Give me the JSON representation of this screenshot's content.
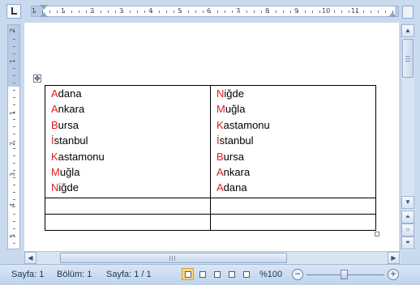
{
  "ruler": {
    "top_numbers": [
      "1",
      "1",
      "2",
      "3",
      "4",
      "5",
      "6",
      "7",
      "8",
      "9",
      "10",
      "11"
    ],
    "left_numbers": [
      "2",
      "1",
      "1",
      "2",
      "3",
      "4",
      "5"
    ]
  },
  "table": {
    "col1": [
      {
        "first": "A",
        "rest": "dana"
      },
      {
        "first": "A",
        "rest": "nkara"
      },
      {
        "first": "B",
        "rest": "ursa"
      },
      {
        "first": "İ",
        "rest": "stanbul"
      },
      {
        "first": "K",
        "rest": "astamonu"
      },
      {
        "first": "M",
        "rest": "uğla"
      },
      {
        "first": "N",
        "rest": "iğde"
      }
    ],
    "col2": [
      {
        "first": "N",
        "rest": "iğde"
      },
      {
        "first": "M",
        "rest": "uğla"
      },
      {
        "first": "K",
        "rest": "astamonu"
      },
      {
        "first": "İ",
        "rest": "stanbul"
      },
      {
        "first": "B",
        "rest": "ursa"
      },
      {
        "first": "A",
        "rest": "nkara"
      },
      {
        "first": "A",
        "rest": "dana"
      }
    ]
  },
  "statusbar": {
    "page": "Sayfa: 1",
    "section": "Bölüm: 1",
    "page_of": "Sayfa: 1 / 1",
    "zoom": "%100"
  },
  "icons": {
    "move_handle": "move-arrows-icon",
    "zoom_out": "minus-icon",
    "zoom_in": "plus-icon"
  },
  "colors": {
    "first_letter": "#e31b1b",
    "chrome": "#c9d9ee"
  }
}
